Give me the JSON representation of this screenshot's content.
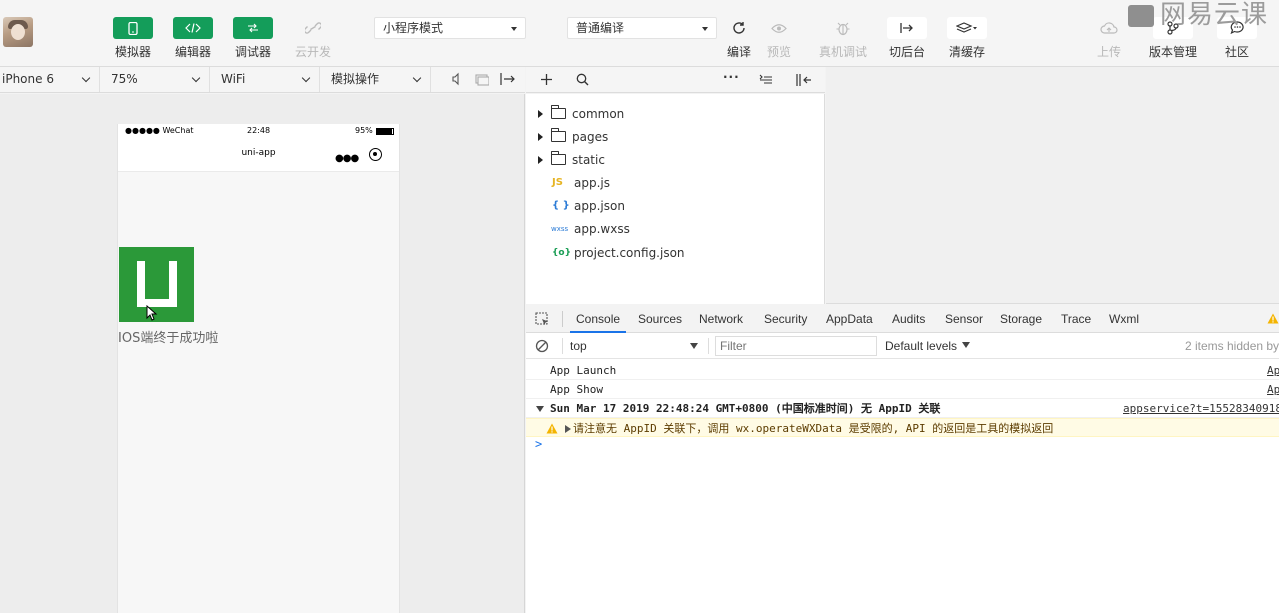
{
  "toolbar": {
    "tools_left": [
      {
        "label": "模拟器",
        "icon": "phone-icon"
      },
      {
        "label": "编辑器",
        "icon": "code-icon"
      },
      {
        "label": "调试器",
        "icon": "debug-icon"
      },
      {
        "label": "云开发",
        "icon": "cloud-link-icon"
      }
    ],
    "mode_select": "小程序模式",
    "compile_select": "普通编译",
    "tools_mid": [
      {
        "label": "编译",
        "icon": "refresh-icon"
      },
      {
        "label": "预览",
        "icon": "eye-icon"
      },
      {
        "label": "真机调试",
        "icon": "bug-icon"
      },
      {
        "label": "切后台",
        "icon": "background-icon"
      },
      {
        "label": "清缓存",
        "icon": "layers-icon"
      }
    ],
    "tools_right": [
      {
        "label": "上传",
        "icon": "upload-cloud-icon"
      },
      {
        "label": "版本管理",
        "icon": "branch-icon"
      },
      {
        "label": "社区",
        "icon": "chat-icon"
      }
    ],
    "watermark": "网易云课"
  },
  "simbar": {
    "device": "iPhone 6",
    "zoom": "75%",
    "network": "WiFi",
    "operation": "模拟操作"
  },
  "phone": {
    "status_carrier": "●●●●● WeChat",
    "status_time": "22:48",
    "status_battery": "95%",
    "nav_title": "uni-app",
    "caption": "IOS端终于成功啦"
  },
  "files": [
    {
      "name": "common",
      "type": "folder"
    },
    {
      "name": "pages",
      "type": "folder"
    },
    {
      "name": "static",
      "type": "folder"
    },
    {
      "name": "app.js",
      "type": "js",
      "badge": "JS"
    },
    {
      "name": "app.json",
      "type": "json",
      "badge": "{ }"
    },
    {
      "name": "app.wxss",
      "type": "wxss",
      "badge": "wxss"
    },
    {
      "name": "project.config.json",
      "type": "config",
      "badge": "{o}"
    }
  ],
  "devtools": {
    "tabs": [
      "Console",
      "Sources",
      "Network",
      "Security",
      "AppData",
      "Audits",
      "Sensor",
      "Storage",
      "Trace",
      "Wxml"
    ],
    "active_tab": "Console",
    "context": "top",
    "filter_placeholder": "Filter",
    "levels": "Default levels",
    "hidden": "2 items hidden by",
    "logs": [
      {
        "text": "App Launch",
        "source": "Ap"
      },
      {
        "text": "App Show",
        "source": "Ap"
      },
      {
        "text": "Sun Mar 17 2019 22:48:24 GMT+0800 (中国标准时间) 无 AppID 关联",
        "source": "appservice?t=15528340918"
      },
      {
        "text": "请注意无 AppID 关联下，调用 wx.operateWXData 是受限的, API 的返回是工具的模拟返回",
        "level": "warning"
      }
    ],
    "prompt": ">"
  },
  "colors": {
    "green": "#149d5a",
    "logo_green": "#2b9939",
    "warn_bg": "#fffbe5",
    "accent": "#1a73e8"
  }
}
